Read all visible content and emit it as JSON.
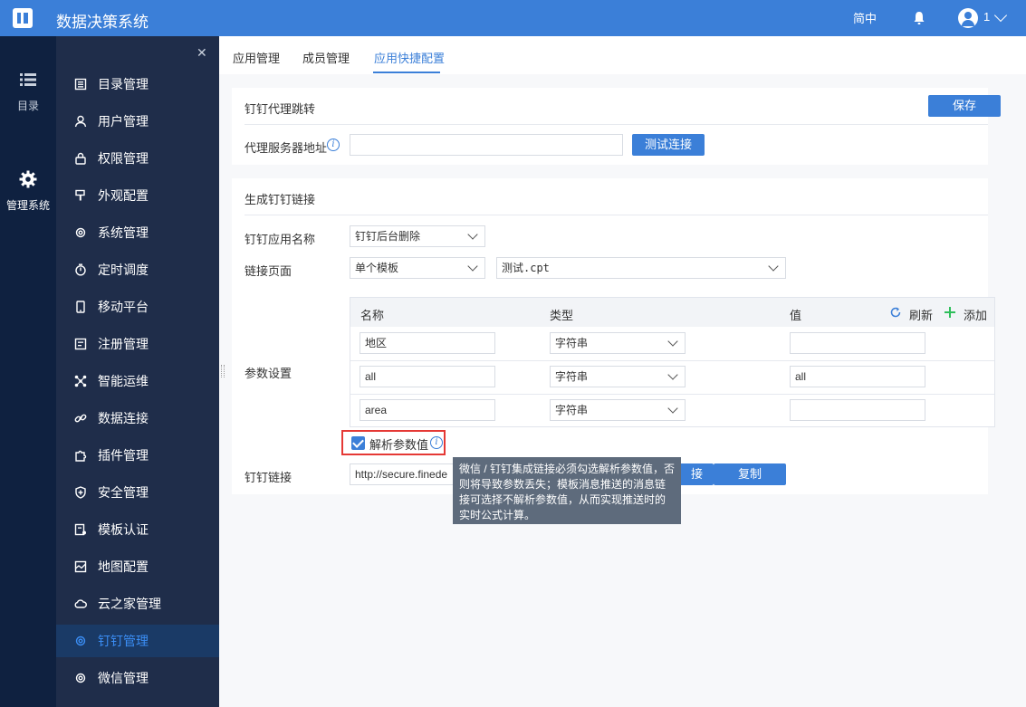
{
  "app": {
    "title": "数据决策系统"
  },
  "header": {
    "language": "简中",
    "user_name": "1"
  },
  "rail": {
    "items": [
      {
        "label": "目录",
        "icon": "list-icon"
      },
      {
        "label": "管理系统",
        "icon": "gear-icon"
      }
    ]
  },
  "sidebar": {
    "items": [
      {
        "label": "目录管理",
        "icon": "catalog-icon"
      },
      {
        "label": "用户管理",
        "icon": "user-icon"
      },
      {
        "label": "权限管理",
        "icon": "lock-icon"
      },
      {
        "label": "外观配置",
        "icon": "brush-icon"
      },
      {
        "label": "系统管理",
        "icon": "gear-icon"
      },
      {
        "label": "定时调度",
        "icon": "timer-icon"
      },
      {
        "label": "移动平台",
        "icon": "mobile-icon"
      },
      {
        "label": "注册管理",
        "icon": "register-icon"
      },
      {
        "label": "智能运维",
        "icon": "network-icon"
      },
      {
        "label": "数据连接",
        "icon": "link-icon"
      },
      {
        "label": "插件管理",
        "icon": "puzzle-icon"
      },
      {
        "label": "安全管理",
        "icon": "shield-icon"
      },
      {
        "label": "模板认证",
        "icon": "template-icon"
      },
      {
        "label": "地图配置",
        "icon": "map-icon"
      },
      {
        "label": "云之家管理",
        "icon": "cloud-icon"
      },
      {
        "label": "钉钉管理",
        "icon": "gear-icon"
      },
      {
        "label": "微信管理",
        "icon": "gear-icon"
      }
    ],
    "active_label": "钉钉管理"
  },
  "tabs": [
    {
      "label": "应用管理"
    },
    {
      "label": "成员管理"
    },
    {
      "label": "应用快捷配置"
    }
  ],
  "proxy_panel": {
    "title": "钉钉代理跳转",
    "save_label": "保存",
    "server_label": "代理服务器地址",
    "server_value": "",
    "test_label": "测试连接"
  },
  "link_panel": {
    "title": "生成钉钉链接",
    "app_name_label": "钉钉应用名称",
    "app_name_value": "钉钉后台删除",
    "link_page_label": "链接页面",
    "link_page_type": "单个模板",
    "link_page_file": "测试.cpt",
    "params_label": "参数设置",
    "columns": {
      "name": "名称",
      "type": "类型",
      "value": "值"
    },
    "refresh_label": "刷新",
    "add_label": "添加",
    "params": [
      {
        "name": "地区",
        "type": "字符串",
        "value": ""
      },
      {
        "name": "all",
        "type": "字符串",
        "value": "all"
      },
      {
        "name": "area",
        "type": "字符串",
        "value": ""
      }
    ],
    "parse_label": "解析参数值",
    "parse_checked": true,
    "tooltip": "微信 / 钉钉集成链接必须勾选解析参数值，否则将导致参数丢失；模板消息推送的消息链接可选择不解析参数值，从而实现推送时的实时公式计算。",
    "dingtalk_link_label": "钉钉链接",
    "dingtalk_link_value": "http://secure.finede",
    "test_link_label": "接",
    "copy_label": "复制"
  },
  "colors": {
    "primary": "#3b7fd8",
    "sidebar_bg": "#1f2d4a",
    "rail_bg": "#0f2140",
    "highlight_border": "#e53935"
  }
}
